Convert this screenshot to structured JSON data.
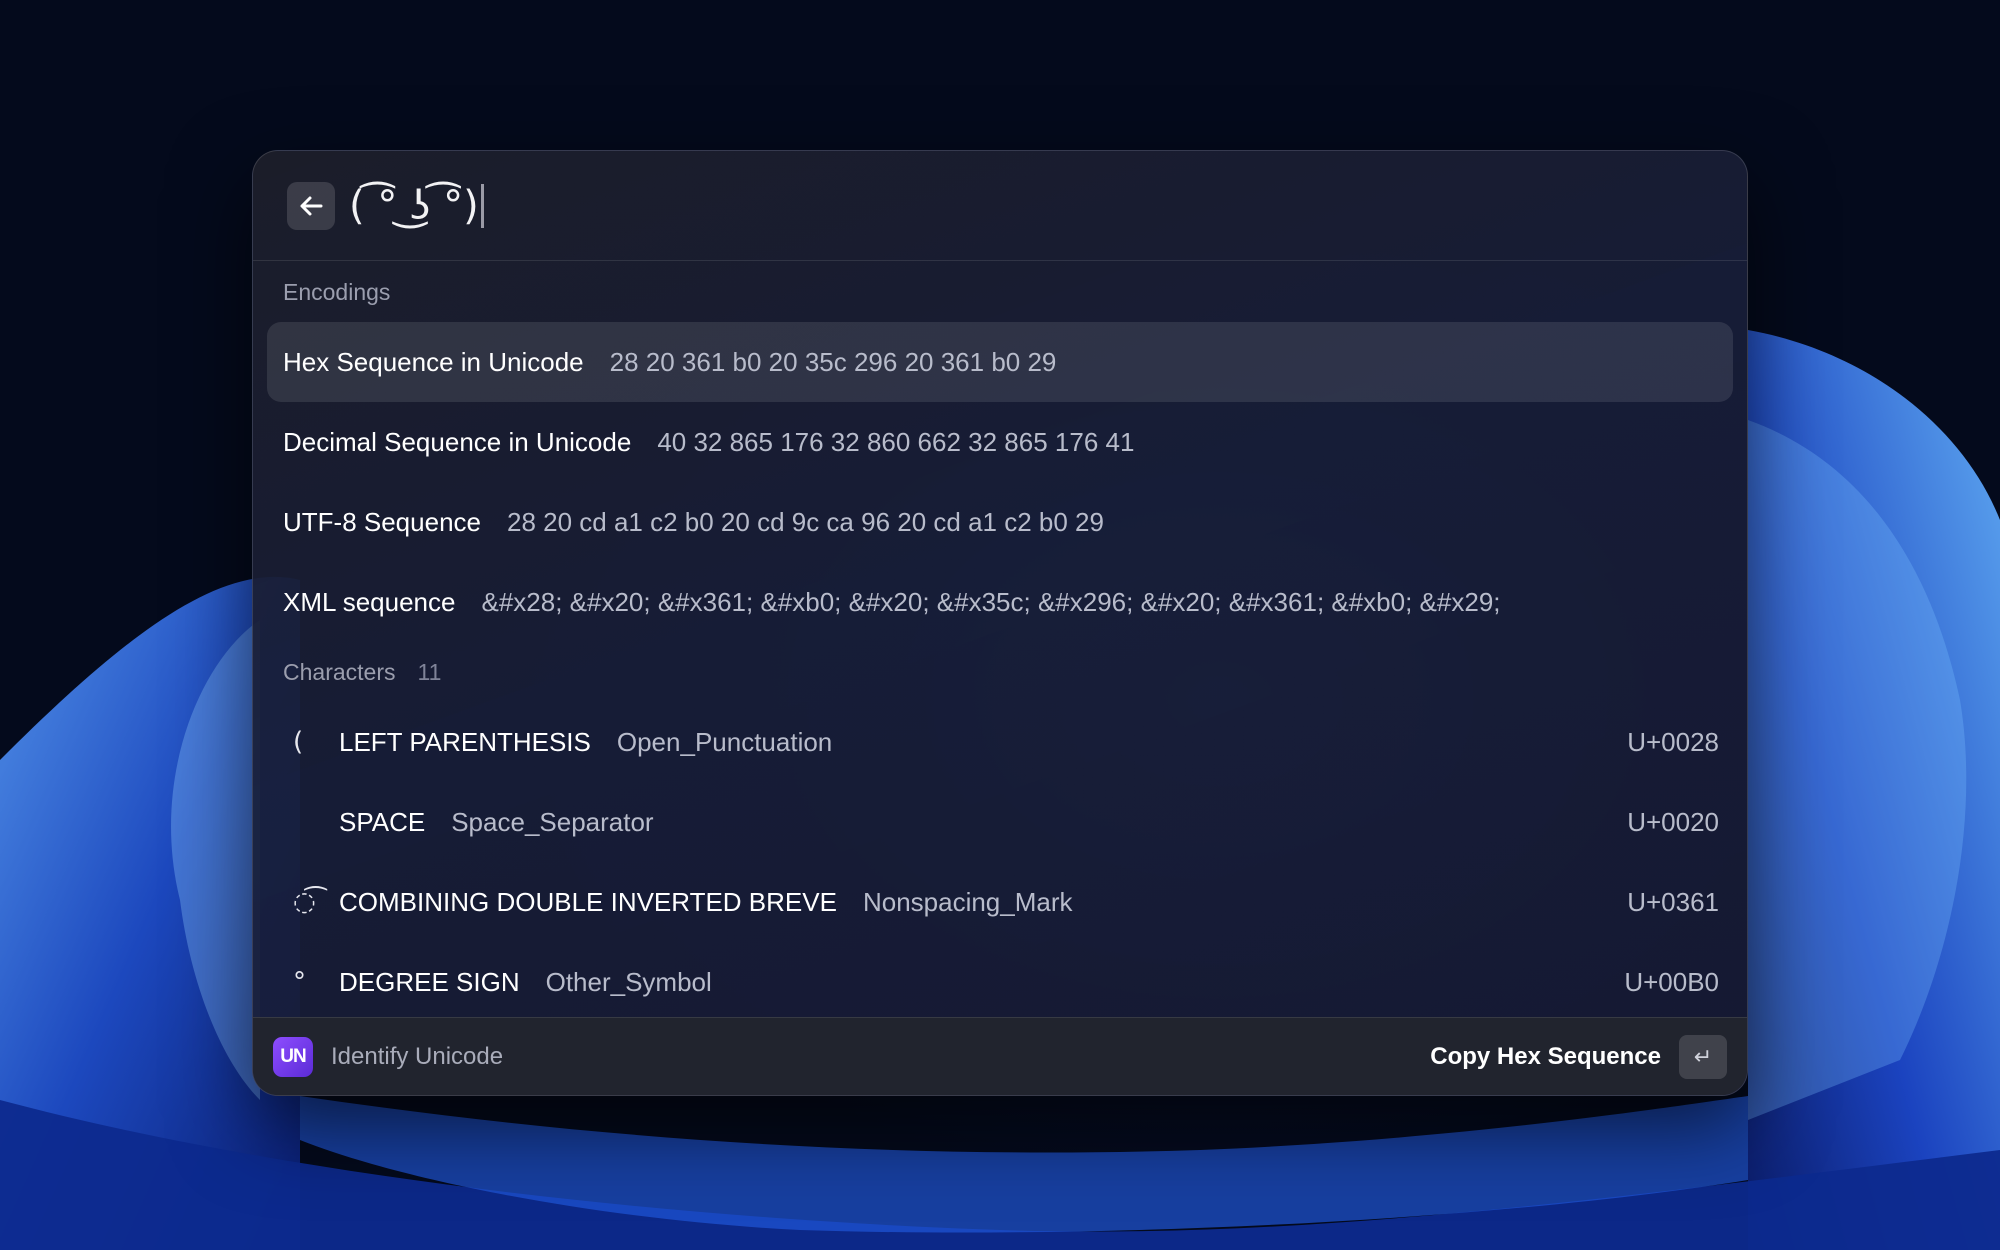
{
  "search": {
    "query": "( ͡° ͜ʖ ͡°)"
  },
  "encodings": {
    "title": "Encodings",
    "items": [
      {
        "label": "Hex Sequence in Unicode",
        "value": "28 20 361 b0 20 35c 296 20 361 b0 29",
        "selected": true
      },
      {
        "label": "Decimal Sequence in Unicode",
        "value": "40 32 865 176 32 860 662 32 865 176 41",
        "selected": false
      },
      {
        "label": "UTF-8 Sequence",
        "value": "28 20 cd a1 c2 b0 20 cd 9c ca 96 20 cd a1 c2 b0 29",
        "selected": false
      },
      {
        "label": "XML sequence",
        "value": "&#x28; &#x20; &#x361; &#xb0; &#x20; &#x35c; &#x296; &#x20; &#x361; &#xb0; &#x29;",
        "selected": false
      }
    ]
  },
  "characters": {
    "title": "Characters",
    "count": "11",
    "items": [
      {
        "glyph": "(",
        "name": "LEFT PARENTHESIS",
        "category": "Open_Punctuation",
        "codepoint": "U+0028"
      },
      {
        "glyph": " ",
        "name": "SPACE",
        "category": "Space_Separator",
        "codepoint": "U+0020"
      },
      {
        "glyph": "◌͡",
        "name": "COMBINING DOUBLE INVERTED BREVE",
        "category": "Nonspacing_Mark",
        "codepoint": "U+0361"
      },
      {
        "glyph": "°",
        "name": "DEGREE SIGN",
        "category": "Other_Symbol",
        "codepoint": "U+00B0"
      }
    ]
  },
  "footer": {
    "extension_icon_text": "UN",
    "extension_name": "Identify Unicode",
    "action_label": "Copy Hex Sequence",
    "enter_key": "↵"
  },
  "colors": {
    "accent": "#7b3ff2",
    "selected_row": "#363a4e"
  },
  "icons": {
    "back": "arrow-left-icon",
    "enter": "return-key-icon"
  }
}
